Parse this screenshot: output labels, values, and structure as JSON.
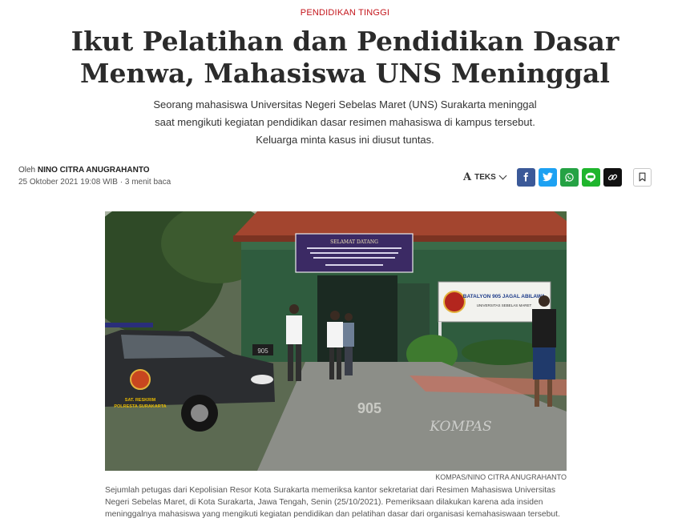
{
  "article": {
    "kicker": "PENDIDIKAN TINGGI",
    "title_line1": "Ikut Pelatihan dan Pendidikan Dasar",
    "title_line2": "Menwa, Mahasiswa UNS Meninggal",
    "lede_line1": "Seorang mahasiswa Universitas Negeri Sebelas Maret (UNS) Surakarta meninggal",
    "lede_line2": "saat mengikuti kegiatan pendidikan dasar resimen mahasiswa di kampus tersebut.",
    "lede_line3": "Keluarga minta kasus ini diusut tuntas.",
    "byline_prefix": "Oleh",
    "author": "NINO CITRA ANUGRAHANTO",
    "date": "25 Oktober 2021 19:08 WIB",
    "separator": "·",
    "read_time": "3 menit baca"
  },
  "toolbar": {
    "text_size_glyph": "A",
    "text_size_label": "TEKS",
    "share_icons": [
      "facebook-icon",
      "twitter-icon",
      "whatsapp-icon",
      "line-icon",
      "copy-link-icon"
    ],
    "bookmark_icon": "bookmark-icon",
    "colors": {
      "facebook": "#3b5998",
      "twitter": "#1da1f2",
      "whatsapp": "#25a244",
      "line": "#1fb52d",
      "copy_link": "#111111"
    }
  },
  "photo": {
    "banner_heading": "SELAMAT DATANG",
    "sign_text": "BATALYON 905 JAGAL ABILAWA",
    "sign_subtext": "UNIVERSITAS SEBELAS MARET",
    "car_door_line1": "SAT. RESKRIM",
    "car_door_line2": "POLRESTA SURAKARTA",
    "car_plate": "905",
    "road_paint": "905",
    "watermark": "KOMPAS",
    "credit": "KOMPAS/NINO CITRA ANUGRAHANTO",
    "caption_line1": "Sejumlah petugas dari Kepolisian Resor Kota Surakarta memeriksa kantor sekretariat dari Resimen Mahasiswa Universitas",
    "caption_line2": "Negeri Sebelas Maret, di Kota Surakarta, Jawa Tengah, Senin (25/10/2021). Pemeriksaan dilakukan karena ada insiden",
    "caption_line3": "meninggalnya mahasiswa yang mengikuti kegiatan pendidikan dan pelatihan dasar dari organisasi kemahasiswaan tersebut."
  }
}
